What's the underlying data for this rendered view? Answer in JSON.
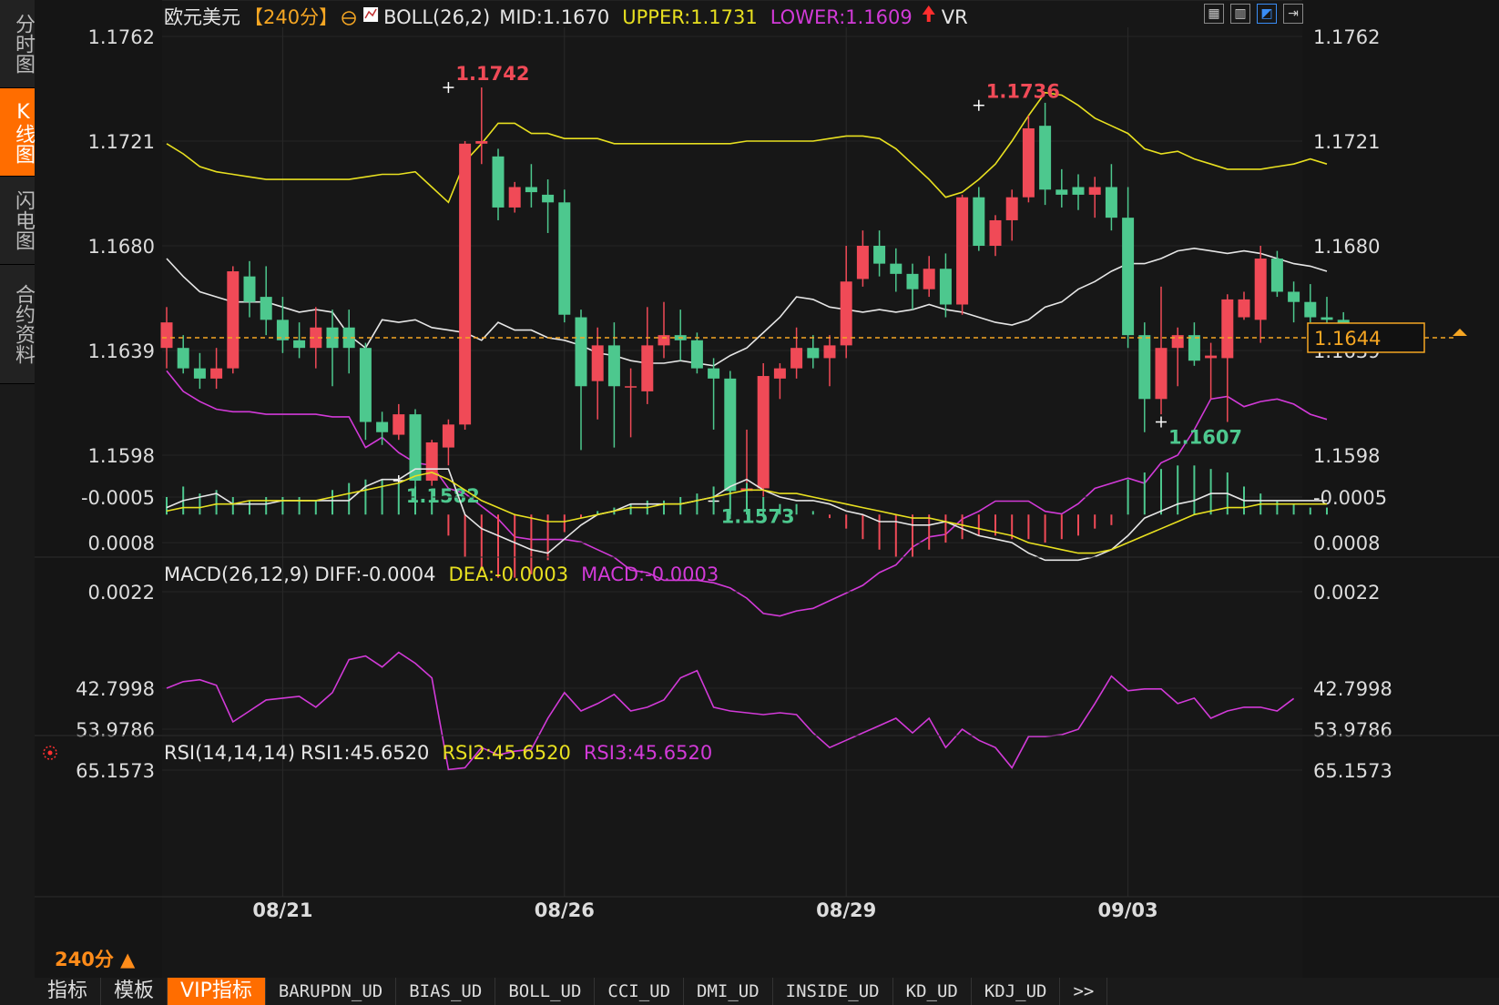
{
  "sidebar": {
    "tabs": [
      {
        "label": "分时图",
        "active": false
      },
      {
        "label": "K线图",
        "active": true
      },
      {
        "label": "闪电图",
        "active": false
      },
      {
        "label": "合约资料",
        "active": false
      }
    ]
  },
  "header": {
    "symbol": "欧元美元",
    "period_tag": "【240分】",
    "boll_label": "BOLL(26,2)",
    "mid": "MID:1.1670",
    "upper": "UPPER:1.1731",
    "lower": "LOWER:1.1609",
    "vr": "VR"
  },
  "toolbar_icons": [
    "grid-icon",
    "chart-icon",
    "kline-icon",
    "exit-icon"
  ],
  "period_selector": "240分 ▲",
  "bottom_tabs": [
    {
      "label": "指标",
      "active": false,
      "cn": true
    },
    {
      "label": "模板",
      "active": false,
      "cn": true
    },
    {
      "label": "VIP指标",
      "active": true,
      "cn": true
    },
    {
      "label": "BARUPDN_UD",
      "active": false
    },
    {
      "label": "BIAS_UD",
      "active": false
    },
    {
      "label": "BOLL_UD",
      "active": false
    },
    {
      "label": "CCI_UD",
      "active": false
    },
    {
      "label": "DMI_UD",
      "active": false
    },
    {
      "label": "INSIDE_UD",
      "active": false
    },
    {
      "label": "KD_UD",
      "active": false
    },
    {
      "label": "KDJ_UD",
      "active": false
    },
    {
      "label": ">>",
      "active": false
    }
  ],
  "colors": {
    "up": "#f04a57",
    "down": "#4dc88e",
    "upper": "#e8e020",
    "lower": "#d23ad8",
    "mid": "#e6e6e6",
    "price_line": "#f5a623",
    "accent": "#ff6d00"
  },
  "chart_data": [
    {
      "type": "candlestick",
      "name": "price",
      "ylabels": [
        "1.1762",
        "1.1721",
        "1.1680",
        "1.1639",
        "1.1598"
      ],
      "ylim": [
        1.1562,
        1.177
      ],
      "xlabels": [
        {
          "index": 7,
          "label": "08/21"
        },
        {
          "index": 24,
          "label": "08/26"
        },
        {
          "index": 41,
          "label": "08/29"
        },
        {
          "index": 58,
          "label": "09/03"
        }
      ],
      "current_price": "1.1644",
      "current_value": 1.1644,
      "annotations": [
        {
          "index": 17,
          "value": 1.1742,
          "label": "1.1742",
          "pos": "high"
        },
        {
          "index": 14,
          "value": 1.1588,
          "label": "1.1582",
          "pos": "low"
        },
        {
          "index": 33,
          "value": 1.158,
          "label": "1.1573",
          "pos": "low"
        },
        {
          "index": 49,
          "value": 1.1735,
          "label": "1.1736",
          "pos": "high"
        },
        {
          "index": 60,
          "value": 1.1611,
          "label": "1.1607",
          "pos": "low"
        }
      ],
      "ohlc": [
        [
          1.164,
          1.1656,
          1.1632,
          1.165
        ],
        [
          1.164,
          1.1645,
          1.163,
          1.1632
        ],
        [
          1.1632,
          1.1638,
          1.1624,
          1.1628
        ],
        [
          1.1628,
          1.164,
          1.1624,
          1.1632
        ],
        [
          1.1632,
          1.1672,
          1.163,
          1.167
        ],
        [
          1.1668,
          1.1674,
          1.1652,
          1.1658
        ],
        [
          1.166,
          1.1672,
          1.1645,
          1.1651
        ],
        [
          1.1651,
          1.166,
          1.1638,
          1.1643
        ],
        [
          1.1643,
          1.165,
          1.1636,
          1.164
        ],
        [
          1.164,
          1.1656,
          1.1632,
          1.1648
        ],
        [
          1.1648,
          1.1655,
          1.1625,
          1.164
        ],
        [
          1.1648,
          1.1655,
          1.163,
          1.164
        ],
        [
          1.164,
          1.1642,
          1.1604,
          1.1611
        ],
        [
          1.1611,
          1.1615,
          1.1602,
          1.1607
        ],
        [
          1.1606,
          1.1618,
          1.1604,
          1.1614
        ],
        [
          1.1614,
          1.1616,
          1.1585,
          1.1588
        ],
        [
          1.1588,
          1.1604,
          1.1586,
          1.1603
        ],
        [
          1.1601,
          1.1612,
          1.1594,
          1.161
        ],
        [
          1.161,
          1.1721,
          1.1608,
          1.172
        ],
        [
          1.172,
          1.1742,
          1.1712,
          1.1721
        ],
        [
          1.1715,
          1.1718,
          1.169,
          1.1695
        ],
        [
          1.1695,
          1.1705,
          1.1693,
          1.1703
        ],
        [
          1.1703,
          1.1712,
          1.1695,
          1.1701
        ],
        [
          1.17,
          1.1706,
          1.1685,
          1.1697
        ],
        [
          1.1697,
          1.1702,
          1.165,
          1.1653
        ],
        [
          1.1652,
          1.1655,
          1.16,
          1.1625
        ],
        [
          1.1627,
          1.1648,
          1.1612,
          1.1641
        ],
        [
          1.1641,
          1.165,
          1.1601,
          1.1625
        ],
        [
          1.1625,
          1.1632,
          1.1605,
          1.1625
        ],
        [
          1.1623,
          1.1656,
          1.1618,
          1.1641
        ],
        [
          1.1641,
          1.1658,
          1.1636,
          1.1645
        ],
        [
          1.1645,
          1.1655,
          1.1635,
          1.1643
        ],
        [
          1.1643,
          1.1646,
          1.163,
          1.1632
        ],
        [
          1.1632,
          1.1636,
          1.1608,
          1.1628
        ],
        [
          1.1628,
          1.1631,
          1.1573,
          1.1584
        ],
        [
          1.1584,
          1.1608,
          1.158,
          1.1585
        ],
        [
          1.1585,
          1.1634,
          1.158,
          1.1629
        ],
        [
          1.1628,
          1.1634,
          1.162,
          1.1632
        ],
        [
          1.1632,
          1.1648,
          1.1628,
          1.164
        ],
        [
          1.164,
          1.1645,
          1.1632,
          1.1636
        ],
        [
          1.1636,
          1.1645,
          1.1625,
          1.1641
        ],
        [
          1.1641,
          1.168,
          1.1636,
          1.1666
        ],
        [
          1.1667,
          1.1686,
          1.1664,
          1.168
        ],
        [
          1.168,
          1.1686,
          1.1668,
          1.1673
        ],
        [
          1.1673,
          1.1679,
          1.1662,
          1.1669
        ],
        [
          1.1669,
          1.1673,
          1.1655,
          1.1663
        ],
        [
          1.1663,
          1.1676,
          1.166,
          1.1671
        ],
        [
          1.1671,
          1.1677,
          1.1652,
          1.1657
        ],
        [
          1.1657,
          1.17,
          1.1653,
          1.1699
        ],
        [
          1.1699,
          1.1703,
          1.1678,
          1.168
        ],
        [
          1.168,
          1.1692,
          1.1676,
          1.169
        ],
        [
          1.169,
          1.1702,
          1.1682,
          1.1699
        ],
        [
          1.1699,
          1.1731,
          1.1697,
          1.1726
        ],
        [
          1.1727,
          1.1736,
          1.1696,
          1.1702
        ],
        [
          1.1702,
          1.171,
          1.1695,
          1.17
        ],
        [
          1.1703,
          1.1708,
          1.1694,
          1.17
        ],
        [
          1.17,
          1.1707,
          1.1691,
          1.1703
        ],
        [
          1.1703,
          1.1712,
          1.1686,
          1.1691
        ],
        [
          1.1691,
          1.1703,
          1.164,
          1.1645
        ],
        [
          1.1645,
          1.165,
          1.1607,
          1.162
        ],
        [
          1.162,
          1.1664,
          1.1614,
          1.164
        ],
        [
          1.164,
          1.1648,
          1.1625,
          1.1645
        ],
        [
          1.1645,
          1.165,
          1.1633,
          1.1635
        ],
        [
          1.1636,
          1.1642,
          1.162,
          1.1637
        ],
        [
          1.1636,
          1.1661,
          1.1611,
          1.1659
        ],
        [
          1.1652,
          1.1662,
          1.1651,
          1.1659
        ],
        [
          1.1651,
          1.168,
          1.1642,
          1.1675
        ],
        [
          1.1675,
          1.1678,
          1.166,
          1.1662
        ],
        [
          1.1662,
          1.1666,
          1.165,
          1.1658
        ],
        [
          1.1658,
          1.1665,
          1.165,
          1.1652
        ],
        [
          1.1652,
          1.166,
          1.1641,
          1.1651
        ],
        [
          1.1651,
          1.1654,
          1.1641,
          1.1644
        ]
      ],
      "mid": [
        1.1675,
        1.1668,
        1.1662,
        1.166,
        1.1658,
        1.1658,
        1.1658,
        1.1656,
        1.1654,
        1.1655,
        1.1654,
        1.1645,
        1.164,
        1.1651,
        1.165,
        1.1651,
        1.1648,
        1.1647,
        1.1646,
        1.1643,
        1.165,
        1.1647,
        1.1647,
        1.1644,
        1.1643,
        1.1641,
        1.1638,
        1.1637,
        1.1635,
        1.1634,
        1.1634,
        1.1635,
        1.1634,
        1.1633,
        1.1637,
        1.164,
        1.1646,
        1.1652,
        1.166,
        1.1659,
        1.1656,
        1.1655,
        1.1654,
        1.1655,
        1.1654,
        1.1655,
        1.1657,
        1.1655,
        1.1654,
        1.1652,
        1.165,
        1.1649,
        1.1651,
        1.1656,
        1.1658,
        1.1663,
        1.1666,
        1.167,
        1.1673,
        1.1673,
        1.1675,
        1.1678,
        1.1679,
        1.1678,
        1.1677,
        1.1678,
        1.1677,
        1.1675,
        1.1673,
        1.1672,
        1.167
      ],
      "upper": [
        1.172,
        1.1716,
        1.1711,
        1.1709,
        1.1708,
        1.1707,
        1.1706,
        1.1706,
        1.1706,
        1.1706,
        1.1706,
        1.1706,
        1.1707,
        1.1708,
        1.1708,
        1.1709,
        1.1703,
        1.1697,
        1.1713,
        1.172,
        1.1728,
        1.1728,
        1.1724,
        1.1724,
        1.1722,
        1.1722,
        1.1722,
        1.172,
        1.172,
        1.172,
        1.172,
        1.172,
        1.172,
        1.172,
        1.172,
        1.1721,
        1.1721,
        1.1721,
        1.1721,
        1.1721,
        1.1722,
        1.1723,
        1.1723,
        1.1722,
        1.1718,
        1.1712,
        1.1706,
        1.1699,
        1.1701,
        1.1706,
        1.1712,
        1.1721,
        1.1731,
        1.174,
        1.1739,
        1.1735,
        1.173,
        1.1727,
        1.1724,
        1.1718,
        1.1716,
        1.1717,
        1.1714,
        1.1712,
        1.171,
        1.171,
        1.171,
        1.1711,
        1.1712,
        1.1714,
        1.1712
      ],
      "lower": [
        1.1631,
        1.1623,
        1.1619,
        1.1616,
        1.1615,
        1.1615,
        1.1614,
        1.1614,
        1.1614,
        1.1614,
        1.1613,
        1.1613,
        1.1601,
        1.1605,
        1.1599,
        1.1595,
        1.1594,
        1.1585,
        1.1583,
        1.1578,
        1.1573,
        1.1566,
        1.1565,
        1.1565,
        1.1565,
        1.1564,
        1.1561,
        1.1558,
        1.1553,
        1.1552,
        1.1549,
        1.1549,
        1.1549,
        1.1548,
        1.1546,
        1.1542,
        1.1536,
        1.1535,
        1.1537,
        1.1538,
        1.1541,
        1.1544,
        1.1547,
        1.1552,
        1.1555,
        1.1562,
        1.1566,
        1.1567,
        1.1573,
        1.1576,
        1.158,
        1.158,
        1.158,
        1.1576,
        1.1575,
        1.1579,
        1.1585,
        1.1587,
        1.1589,
        1.1587,
        1.1595,
        1.1598,
        1.1608,
        1.162,
        1.1621,
        1.1617,
        1.1619,
        1.162,
        1.1618,
        1.1614,
        1.1612
      ]
    },
    {
      "type": "macd",
      "title": "MACD(26,12,9)",
      "diff_label": "DIFF:-0.0004",
      "dea_label": "DEA:-0.0003",
      "macd_label": "MACD:-0.0003",
      "ylabels": [
        "0.0022",
        "0.0008",
        "-0.0005"
      ],
      "ytick_values": [
        0.0022,
        0.0008,
        -0.0005
      ],
      "ylim": [
        -0.0018,
        0.0026
      ],
      "diff": [
        -0.0002,
        -0.0004,
        -0.0005,
        -0.0006,
        -0.0003,
        -0.0003,
        -0.0003,
        -0.0004,
        -0.0004,
        -0.0004,
        -0.0004,
        -0.0004,
        -0.0008,
        -0.001,
        -0.001,
        -0.0013,
        -0.0013,
        -0.0013,
        0.0,
        0.0004,
        0.0006,
        0.0008,
        0.001,
        0.0011,
        0.0007,
        0.0003,
        0.0,
        -0.0001,
        -0.0003,
        -0.0003,
        -0.0003,
        -0.0003,
        -0.0004,
        -0.0005,
        -0.0008,
        -0.001,
        -0.0007,
        -0.0005,
        -0.0004,
        -0.0004,
        -0.0003,
        -0.0001,
        0.0,
        0.0002,
        0.0002,
        0.0003,
        0.0003,
        0.0002,
        0.0004,
        0.0006,
        0.0007,
        0.0008,
        0.0011,
        0.0013,
        0.0013,
        0.0013,
        0.0012,
        0.001,
        0.0006,
        0.0001,
        -0.0001,
        -0.0003,
        -0.0004,
        -0.0006,
        -0.0006,
        -0.0004,
        -0.0004,
        -0.0004,
        -0.0004,
        -0.0004,
        -0.0004
      ],
      "dea": [
        -0.0001,
        -0.0002,
        -0.0002,
        -0.0003,
        -0.0003,
        -0.0004,
        -0.0004,
        -0.0004,
        -0.0004,
        -0.0004,
        -0.0005,
        -0.0006,
        -0.0007,
        -0.0008,
        -0.0009,
        -0.0011,
        -0.0012,
        -0.001,
        -0.0007,
        -0.0004,
        -0.0002,
        0.0,
        0.0001,
        0.0002,
        0.0002,
        0.0001,
        0.0,
        -0.0001,
        -0.0002,
        -0.0002,
        -0.0003,
        -0.0003,
        -0.0004,
        -0.0005,
        -0.0006,
        -0.0007,
        -0.0007,
        -0.0006,
        -0.0006,
        -0.0005,
        -0.0004,
        -0.0003,
        -0.0002,
        -0.0001,
        0.0,
        0.0001,
        0.0001,
        0.0002,
        0.0003,
        0.0004,
        0.0005,
        0.0006,
        0.0008,
        0.0009,
        0.001,
        0.0011,
        0.0011,
        0.001,
        0.0008,
        0.0006,
        0.0004,
        0.0002,
        0.0,
        -0.0001,
        -0.0002,
        -0.0002,
        -0.0003,
        -0.0003,
        -0.0003,
        -0.0003,
        -0.0003
      ],
      "hist": [
        -0.0005,
        -0.0008,
        -0.0006,
        -0.0007,
        -0.0005,
        -0.0004,
        -0.0005,
        -0.0005,
        -0.0005,
        -0.0004,
        -0.0007,
        -0.0009,
        -0.001,
        -0.001,
        -0.0009,
        -0.0008,
        -0.0007,
        0.0006,
        0.0012,
        0.0016,
        0.0018,
        0.0018,
        0.0017,
        0.0013,
        0.0005,
        0.0001,
        -0.0001,
        -0.0002,
        -0.0003,
        -0.0004,
        -0.0004,
        -0.0005,
        -0.0006,
        -0.0008,
        -0.0011,
        -0.0009,
        -0.0005,
        -0.0003,
        -0.0003,
        -0.0001,
        0.0001,
        0.0004,
        0.0007,
        0.001,
        0.0012,
        0.0012,
        0.001,
        0.0008,
        0.0007,
        0.0006,
        0.0006,
        0.0007,
        0.0007,
        0.0008,
        0.0007,
        0.0006,
        0.0004,
        0.0003,
        -0.001,
        -0.0012,
        -0.0013,
        -0.0014,
        -0.0014,
        -0.0013,
        -0.0012,
        -0.0008,
        -0.0006,
        -0.0004,
        -0.0003,
        -0.0002,
        -0.0002
      ]
    },
    {
      "type": "rsi",
      "title": "RSI(14,14,14)",
      "rsi1_label": "RSI1:45.6520",
      "rsi2_label": "RSI2:45.6520",
      "rsi3_label": "RSI3:45.6520",
      "ylabels": [
        "65.1573",
        "53.9786",
        "42.7998"
      ],
      "ytick_values": [
        65.1573,
        53.9786,
        42.7998
      ],
      "ylim": [
        32,
        67
      ],
      "values": [
        42.8,
        41.0,
        40.5,
        42.0,
        52.0,
        49.0,
        46.0,
        45.5,
        45.0,
        48.0,
        44.0,
        35.0,
        34.0,
        37.0,
        33.0,
        36.0,
        40.0,
        65.0,
        64.5,
        59.0,
        61.0,
        60.0,
        59.5,
        51.0,
        44.0,
        49.0,
        47.0,
        44.5,
        49.0,
        48.0,
        46.0,
        40.0,
        38.0,
        48.0,
        49.0,
        49.5,
        50.0,
        49.5,
        50.0,
        55.0,
        59.0,
        57.0,
        55.0,
        53.0,
        51.0,
        55.0,
        51.0,
        59.0,
        54.0,
        57.0,
        59.0,
        64.5,
        56.0,
        56.0,
        55.5,
        54.0,
        47.0,
        39.5,
        43.5,
        43.0,
        43.0,
        47.0,
        45.5,
        51.0,
        49.0,
        48.0,
        48.0,
        49.0,
        45.6
      ]
    }
  ]
}
